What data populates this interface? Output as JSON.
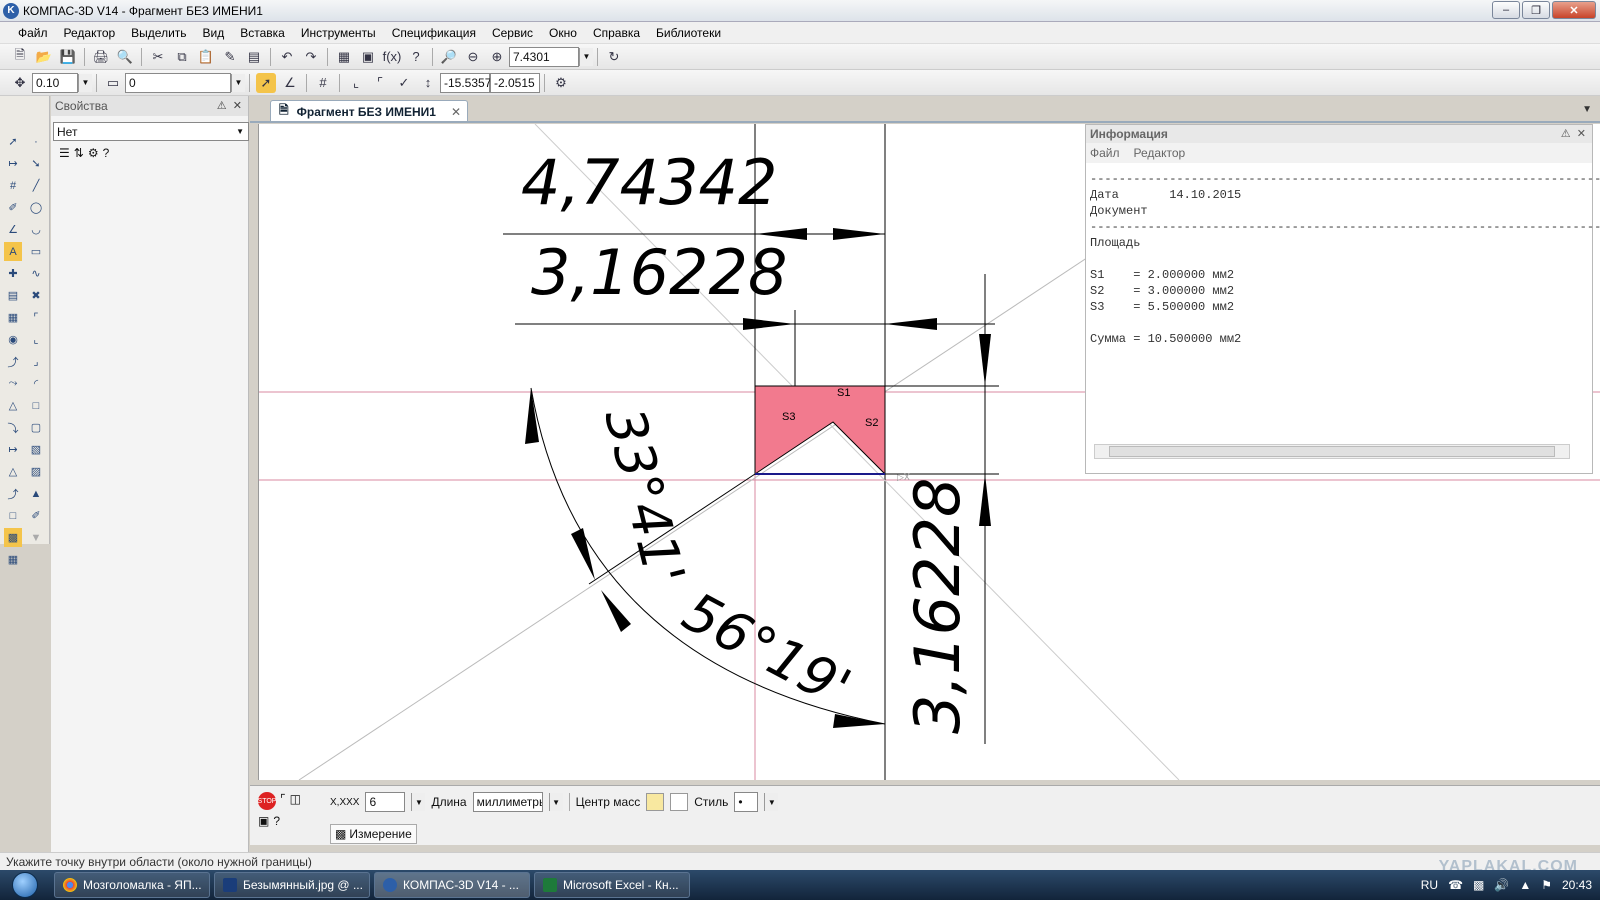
{
  "window": {
    "title": "КОМПАС-3D V14 - Фрагмент БЕЗ ИМЕНИ1",
    "app_icon_letter": "K"
  },
  "menu": [
    "Файл",
    "Редактор",
    "Выделить",
    "Вид",
    "Вставка",
    "Инструменты",
    "Спецификация",
    "Сервис",
    "Окно",
    "Справка",
    "Библиотеки"
  ],
  "toolbar1": {
    "zoom_value": "7.4301"
  },
  "toolbar2": {
    "step_value": "0.10",
    "layer_value": "0",
    "coord_x": "-15.5357",
    "coord_y": "-2.0515"
  },
  "properties_panel": {
    "title": "Свойства",
    "select_value": "Нет"
  },
  "document_tab": {
    "label": "Фрагмент БЕЗ ИМЕНИ1"
  },
  "drawing": {
    "dim_top_outer": "4,74342",
    "dim_top_inner": "3,16228",
    "angle_1": "33°41'",
    "angle_2": "56°19'",
    "dim_right": "3,16228",
    "region_labels": [
      "S1",
      "S2",
      "S3"
    ],
    "fill_color": "#f27a8e",
    "axis_color": "#d98aa0"
  },
  "info_panel": {
    "title": "Информация",
    "menu": [
      "Файл",
      "Редактор"
    ],
    "separator": "--------------------------------------------------------------------------",
    "date_label": "Дата",
    "date_value": "14.10.2015",
    "document_label": "Документ",
    "area_label": "Площадь",
    "s1": "S1    = 2.000000 мм2",
    "s2": "S2    = 3.000000 мм2",
    "s3": "S3    = 5.500000 мм2",
    "sum": "Сумма = 10.500000 мм2"
  },
  "bottom_panel": {
    "precision_label": "X,XXX",
    "precision_value": "6",
    "length_label": "Длина",
    "length_unit": "миллиметры",
    "mass_center_label": "Центр масс",
    "style_label": "Стиль",
    "style_value": "•",
    "tab_label": "Измерение"
  },
  "status": {
    "hint": "Укажите точку внутри области (около нужной границы)"
  },
  "taskbar": {
    "items": [
      "Мозголомалка - ЯП...",
      "Безымянный.jpg @ ...",
      "КОМПАС-3D V14 - ...",
      "Microsoft Excel - Кн..."
    ],
    "lang": "RU",
    "time": "20:43"
  },
  "watermark": "YAPLAKAL.COM"
}
